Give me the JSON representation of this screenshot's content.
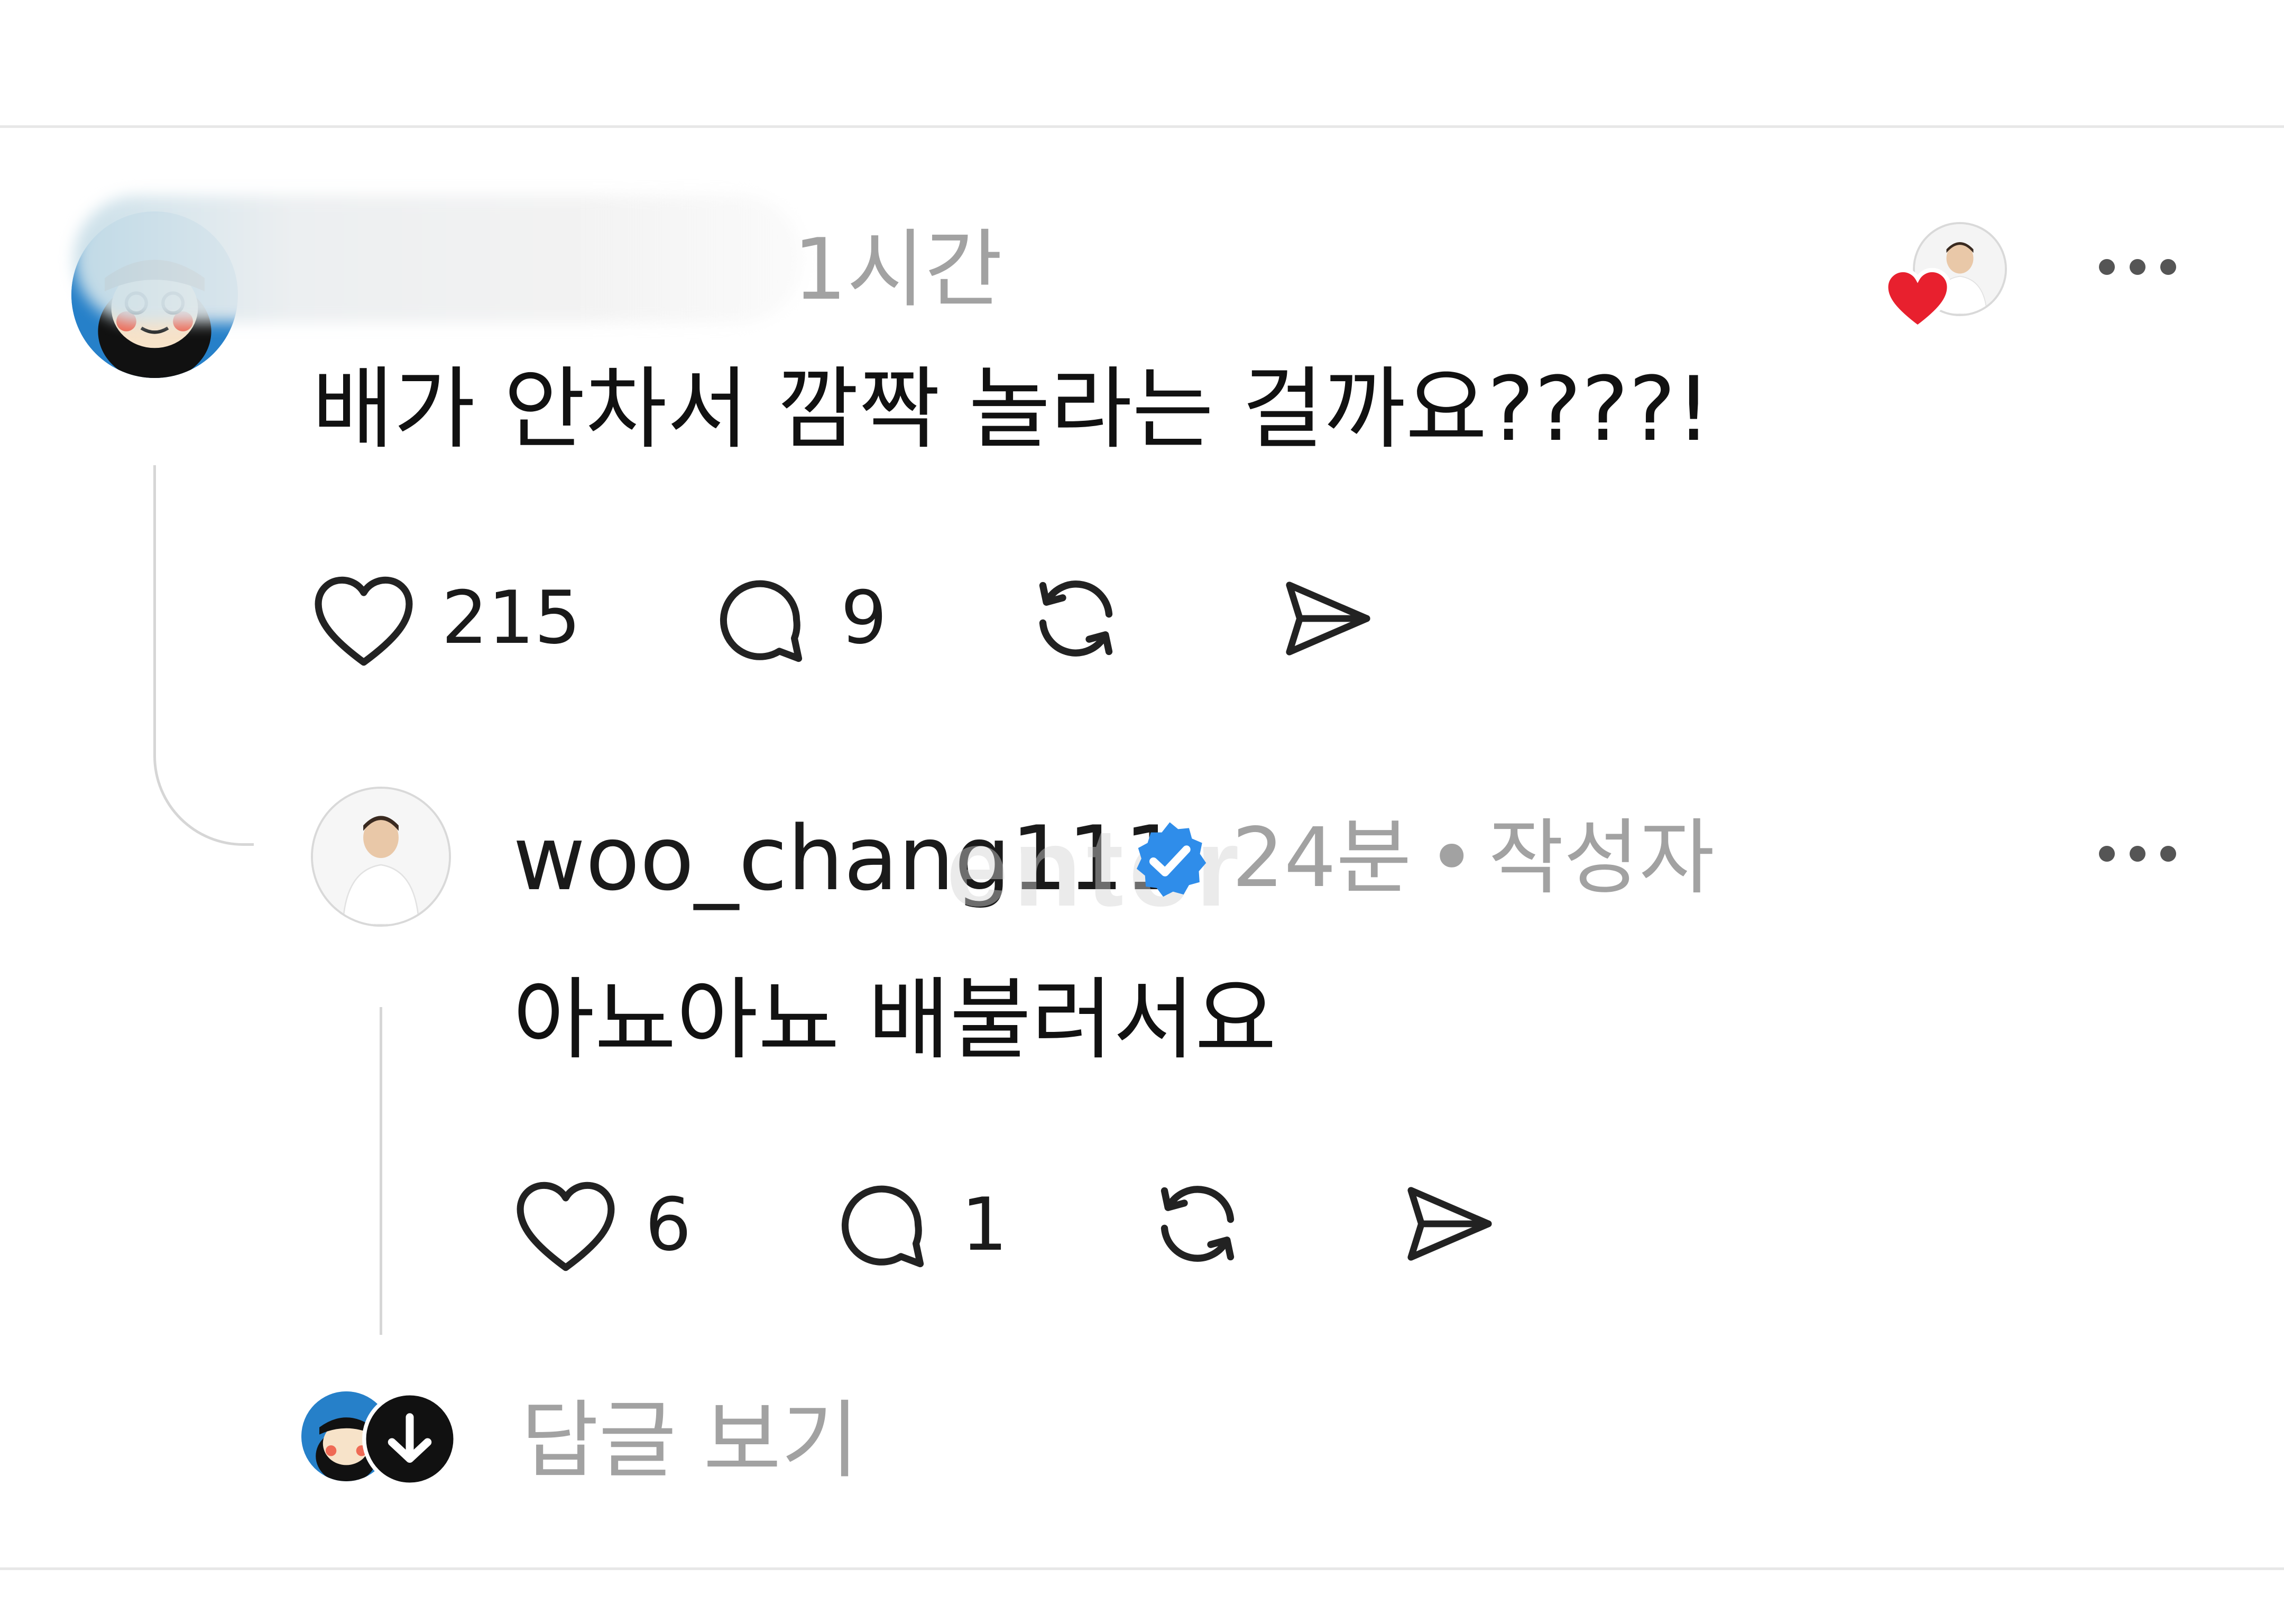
{
  "comment": {
    "time": "1시간",
    "text": "배가 안차서 깜짝 놀라는 걸까요????!",
    "like_count": "215",
    "reply_count": "9",
    "liked_by_author_icon": "heart-icon"
  },
  "reply": {
    "username": "woo_chang111",
    "verified_icon": "verified-badge-icon",
    "time": "24분",
    "separator": "•",
    "author_label": "작성자",
    "text": "아뇨아뇨 배불러서요",
    "like_count": "6",
    "reply_count": "1"
  },
  "view_replies": {
    "label": "답글 보기",
    "icon": "arrow-down-icon"
  },
  "watermark": "enter",
  "colors": {
    "heart": "#e8202e",
    "verified": "#2f8dea",
    "gray_text": "#a2a2a2",
    "primary_text": "#111111"
  }
}
